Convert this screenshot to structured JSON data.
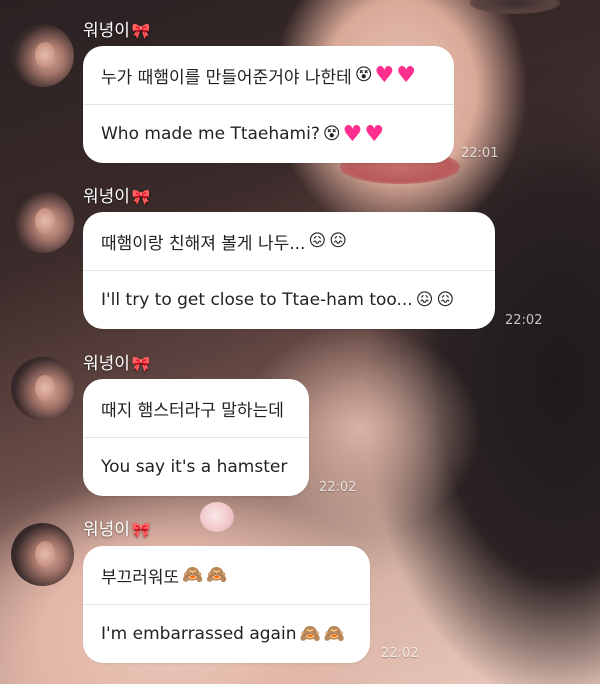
{
  "chat": {
    "messages": [
      {
        "sender": "워녕이",
        "sender_icon": "ribbon-icon",
        "korean": "누가 때햄이를 만들어준거야 나한테",
        "korean_emoji": "😵♥♥",
        "english": "Who made me Ttaehami?",
        "english_emoji": "😵♥♥",
        "time": "22:01"
      },
      {
        "sender": "워녕이",
        "sender_icon": "ribbon-icon",
        "korean": "때햄이랑 친해져 볼게 나두...",
        "korean_emoji": "😖😖",
        "english": "I'll try to get close to Ttae-ham too...",
        "english_emoji": "😖😖",
        "time": "22:02"
      },
      {
        "sender": "워녕이",
        "sender_icon": "ribbon-icon",
        "korean": "때지 햄스터라구 말하는데",
        "korean_emoji": "",
        "english": "You say it's a hamster",
        "english_emoji": "",
        "time": "22:02"
      },
      {
        "sender": "워녕이",
        "sender_icon": "ribbon-icon",
        "korean": "부끄러워또",
        "korean_emoji": "🙈🙈",
        "english": "I'm embarrassed again",
        "english_emoji": "🙈🙈",
        "time": "22:02"
      }
    ]
  },
  "colors": {
    "bubble": "#ffffff",
    "heart": "#ff2f8f",
    "ribbon": "#ff6f9e"
  }
}
